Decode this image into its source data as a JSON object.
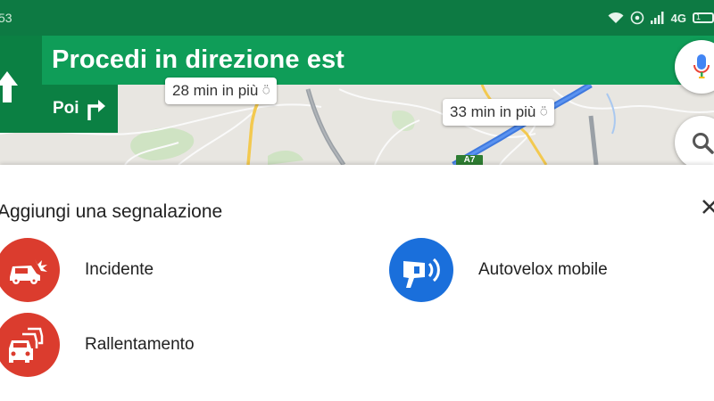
{
  "status_bar": {
    "time": "53",
    "network": "4G",
    "battery": "1"
  },
  "navigation": {
    "instruction": "Procedi in direzione est",
    "then_label": "Poi"
  },
  "map": {
    "alt_routes": [
      {
        "text": "28 min in più"
      },
      {
        "text": "33 min in più"
      }
    ],
    "road_badge": "A7"
  },
  "report_sheet": {
    "title": "Aggiungi una segnalazione",
    "items": [
      {
        "label": "Incidente",
        "icon": "crash-icon",
        "color": "#db3c2e"
      },
      {
        "label": "Autovelox mobile",
        "icon": "speed-camera-icon",
        "color": "#1a6fdb"
      },
      {
        "label": "Rallentamento",
        "icon": "traffic-slowdown-icon",
        "color": "#db3c2e"
      }
    ]
  },
  "colors": {
    "status_bar": "#0d7a43",
    "nav_banner": "#0f9d58",
    "then_box": "#0b8043",
    "route_blue": "#4285f4"
  }
}
